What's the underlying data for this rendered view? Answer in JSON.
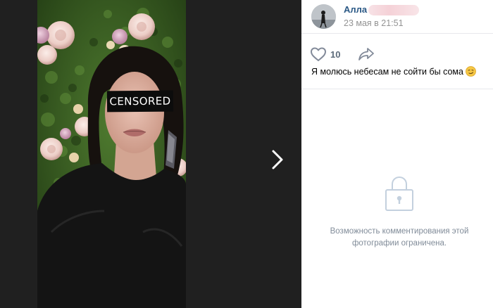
{
  "viewer": {
    "censor_label": "CENSORED",
    "next_icon": "chevron-right-icon"
  },
  "author": {
    "name": "Алла",
    "date": "23 мая в 21:51"
  },
  "actions": {
    "like_icon": "heart-outline-icon",
    "likes_count": "10",
    "share_icon": "share-arrow-icon"
  },
  "caption": {
    "text": "Я молюсь небесам не сойти бы сома",
    "emoji": "smirk-emoji"
  },
  "comments": {
    "lock_icon": "lock-icon",
    "line1": "Возможность комментирования этой",
    "line2": "фотографии ограничена."
  },
  "colors": {
    "link": "#2a5885",
    "muted": "#939393",
    "icon": "#828a99",
    "restricted_text": "#818c99",
    "viewer_bg": "#202020"
  }
}
